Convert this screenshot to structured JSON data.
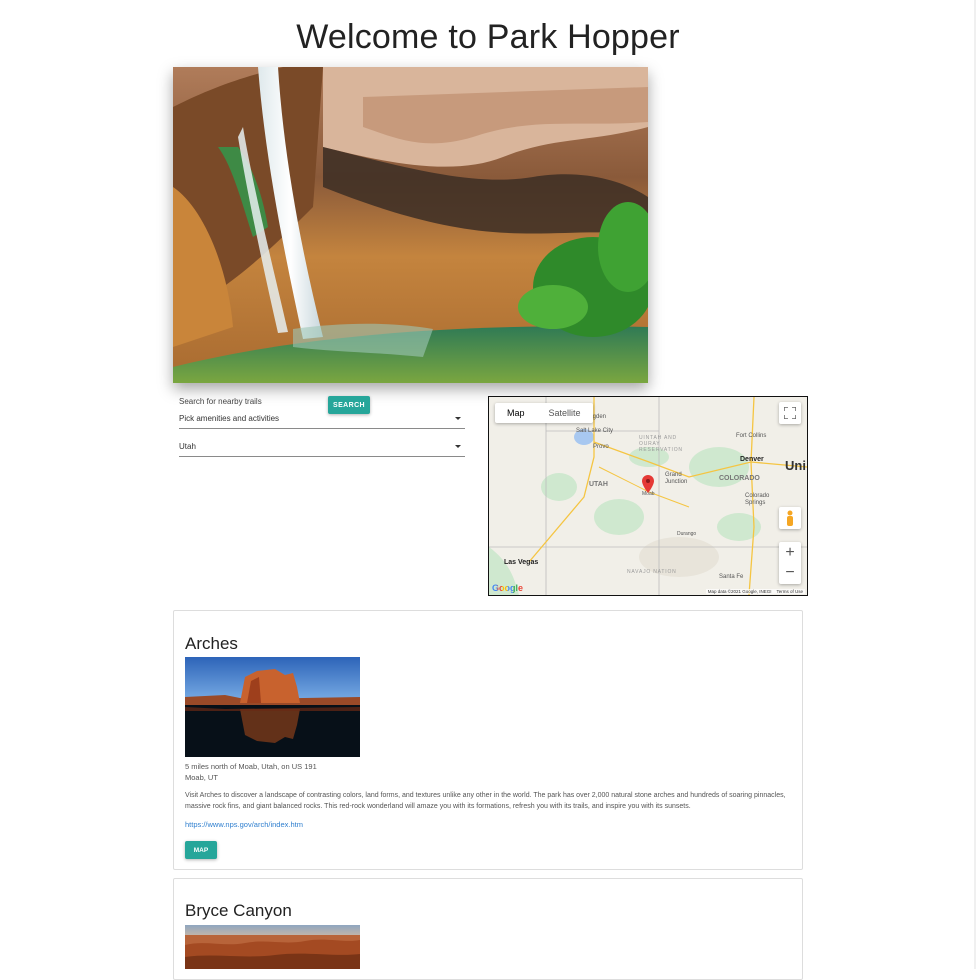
{
  "header": {
    "title": "Welcome to Park Hopper"
  },
  "search": {
    "label": "Search for nearby trails",
    "button_label": "SEARCH",
    "amenities_placeholder": "Pick amenities and activities",
    "state_value": "Utah"
  },
  "map": {
    "tabs": [
      "Map",
      "Satellite"
    ],
    "labels": {
      "salt_lake_city": "Salt Lake City",
      "ogden": "Ogden",
      "provo": "Provo",
      "utah": "UTAH",
      "colorado": "COLORADO",
      "denver": "Denver",
      "fort_collins": "Fort Collins",
      "grand_junction": "Grand Junction",
      "colorado_springs": "Colorado Springs",
      "moab": "Moab",
      "durango": "Durango",
      "santa_fe": "Santa Fe",
      "las_vegas": "Las Vegas",
      "uni": "Uni",
      "navajo_nation": "NAVAJO NATION",
      "uintah": "UINTAH AND OURAY RESERVATION"
    },
    "google_logo": "Google",
    "attribution": "Map data ©2021 Google, INEGI",
    "terms": "Terms of Use",
    "zoom_in": "+",
    "zoom_out": "−"
  },
  "parks": [
    {
      "name": "Arches",
      "address_line1": "5 miles north of Moab, Utah, on US 191",
      "address_line2": "Moab, UT",
      "description": "Visit Arches to discover a landscape of contrasting colors, land forms, and textures unlike any other in the world. The park has over 2,000 natural stone arches and hundreds of soaring pinnacles, massive rock fins, and giant balanced rocks. This red-rock wonderland will amaze you with its formations, refresh you with its trails, and inspire you with its sunsets.",
      "url": "https://www.nps.gov/arch/index.htm",
      "button_label": "MAP"
    },
    {
      "name": "Bryce Canyon"
    }
  ],
  "colors": {
    "accent": "#26a69a",
    "link": "#2f7fcf"
  }
}
